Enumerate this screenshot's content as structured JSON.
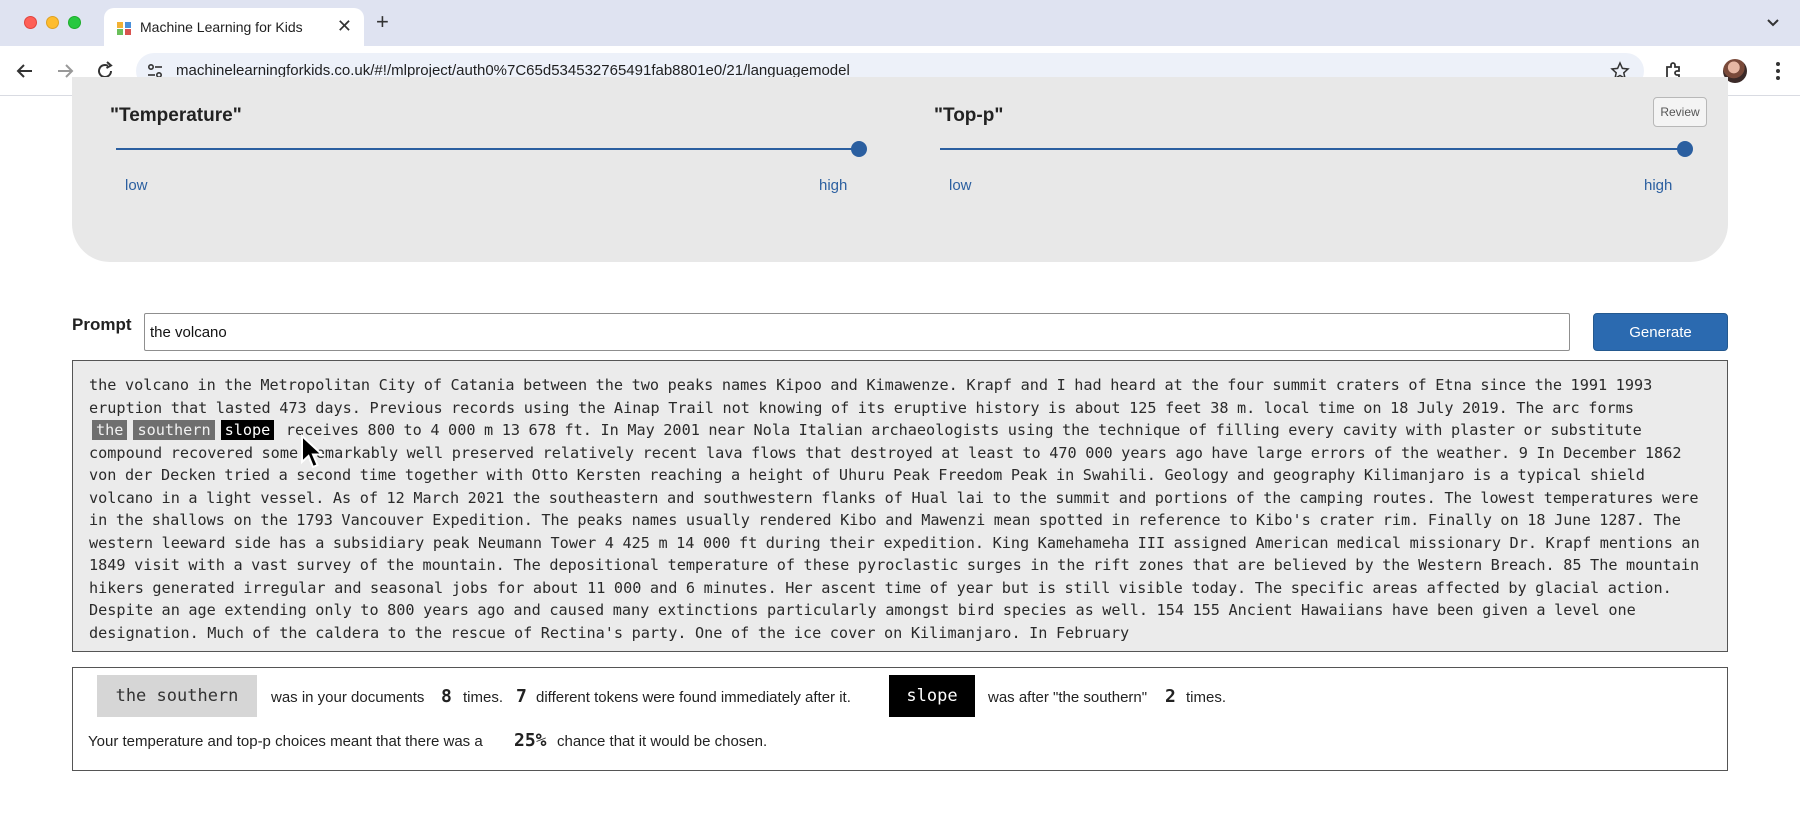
{
  "browser": {
    "tab_title": "Machine Learning for Kids",
    "url": "machinelearningforkids.co.uk/#!/mlproject/auth0%7C65d534532765491fab8801e0/21/languagemodel",
    "icons": [
      "favicon",
      "close-icon",
      "plus-icon",
      "chevron-down-icon",
      "back-arrow-icon",
      "forward-arrow-icon",
      "reload-icon",
      "site-info-icon",
      "star-icon",
      "extensions-icon",
      "avatar",
      "more-vert-icon"
    ]
  },
  "settings": {
    "temperature": {
      "title": "\"Temperature\"",
      "low_label": "low",
      "high_label": "high",
      "value": 1.0
    },
    "top_p": {
      "title": "\"Top-p\"",
      "low_label": "low",
      "high_label": "high",
      "value": 1.0
    },
    "review_label": "Review"
  },
  "prompt": {
    "label": "Prompt",
    "value": "the volcano",
    "generate_label": "Generate"
  },
  "output": {
    "before": "the volcano in the Metropolitan City of Catania between the two peaks names Kipoo and Kimawenze. Krapf and I had heard at the four summit craters of Etna since the 1991 1993 eruption that lasted 473 days. Previous records using the Ainap Trail not knowing of its eruptive history is about 125 feet 38 m. local time on 18 July 2019. The arc forms",
    "token_1": "the",
    "token_2": "southern",
    "token_3": "slope",
    "after": "receives 800 to 4 000 m 13 678 ft. In May 2001 near Nola Italian archaeologists using the technique of filling every cavity with plaster or substitute compound recovered some remarkably well preserved relatively recent lava flows that destroyed at least to 470 000 years ago have large errors of the weather. 9 In December 1862 von der Decken tried a second time together with Otto Kersten reaching a height of Uhuru Peak Freedom Peak in Swahili. Geology and geography Kilimanjaro is a typical shield volcano in a light vessel. As of 12 March 2021 the southeastern and southwestern flanks of Hual lai to the summit and portions of the camping routes. The lowest temperatures were in the shallows on the 1793 Vancouver Expedition. The peaks names usually rendered Kibo and Mawenzi mean spotted in reference to Kibo's crater rim. Finally on 18 June 1287. The western leeward side has a subsidiary peak Neumann Tower 4 425 m 14 000 ft during their expedition. King Kamehameha III assigned American medical missionary Dr. Krapf mentions an 1849 visit with a vast survey of the mountain. The depositional temperature of these pyroclastic surges in the rift zones that are believed by the Western Breach. 85 The mountain hikers generated irregular and seasonal jobs for about 11 000 and 6 minutes. Her ascent time of year but is still visible today. The specific areas affected by glacial action. Despite an age extending only to 800 years ago and caused many extinctions particularly amongst bird species as well. 154 155 Ancient Hawaiians have been given a level one designation. Much of the caldera to the rescue of Rectina's party. One of the ice cover on Kilimanjaro. In February"
  },
  "explanation": {
    "context_token": "the southern",
    "text_1": "was in your documents",
    "count": "8",
    "text_2": "times.",
    "distinct_count": "7",
    "text_3": "different tokens were found immediately after it.",
    "next_token": "slope",
    "text_4": "was after \"the southern\"",
    "next_count": "2",
    "text_5": "times.",
    "text_6": "Your temperature and top-p choices meant that there was a",
    "chance": "25%",
    "text_7": "chance that it would be chosen."
  }
}
